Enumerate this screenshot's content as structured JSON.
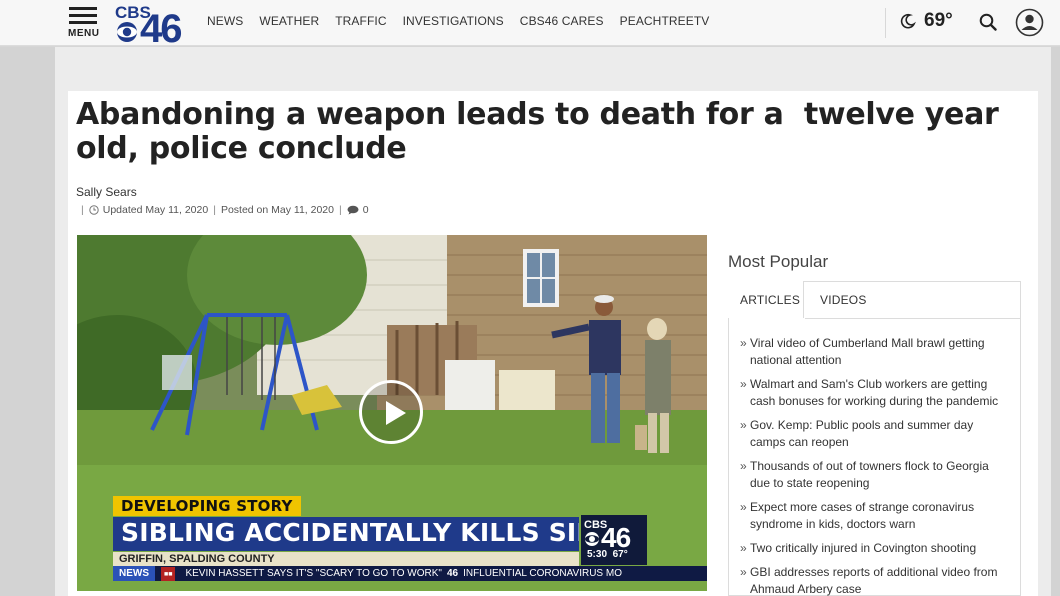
{
  "header": {
    "menu_label": "MENU",
    "logo_text": "CBS46",
    "nav": [
      "NEWS",
      "WEATHER",
      "TRAFFIC",
      "INVESTIGATIONS",
      "CBS46 CARES",
      "PEACHTREETV"
    ],
    "temperature": "69°",
    "weather_icon": "moon-icon",
    "search_icon": "search-icon",
    "account_icon": "user-icon"
  },
  "article": {
    "headline": "Abandoning a weapon leads to death for a  twelve year old, police conclude",
    "author": "Sally Sears",
    "updated": "Updated May 11, 2020",
    "posted": "Posted on May 11, 2020",
    "comments": "0"
  },
  "video": {
    "tag": "DEVELOPING STORY",
    "headline": "SIBLING ACCIDENTALLY KILLS SIBLING",
    "location": "GRIFFIN, SPALDING COUNTY",
    "station_logo": "CBS46",
    "time": "5:30",
    "temp": "67°",
    "ticker_label": "NEWS",
    "ticker_text_1": "KEVIN HASSETT SAYS IT'S \"SCARY TO GO TO WORK\"",
    "ticker_sep": "46",
    "ticker_text_2": "INFLUENTIAL CORONAVIRUS MO",
    "play_icon": "play-icon"
  },
  "sidebar": {
    "title": "Most Popular",
    "tabs": [
      "ARTICLES",
      "VIDEOS"
    ],
    "items": [
      "Viral video of Cumberland Mall brawl getting national attention",
      "Walmart and Sam's Club workers are getting cash bonuses for working during the pandemic",
      "Gov. Kemp: Public pools and summer day camps can reopen",
      "Thousands of out of towners flock to Georgia due to state reopening",
      "Expect more cases of strange coronavirus syndrome in kids, doctors warn",
      "Two critically injured in Covington shooting",
      "GBI addresses reports of additional video from Ahmaud Arbery case"
    ]
  },
  "colors": {
    "brand_blue": "#1f3a8a",
    "tag_yellow": "#f0c400"
  }
}
